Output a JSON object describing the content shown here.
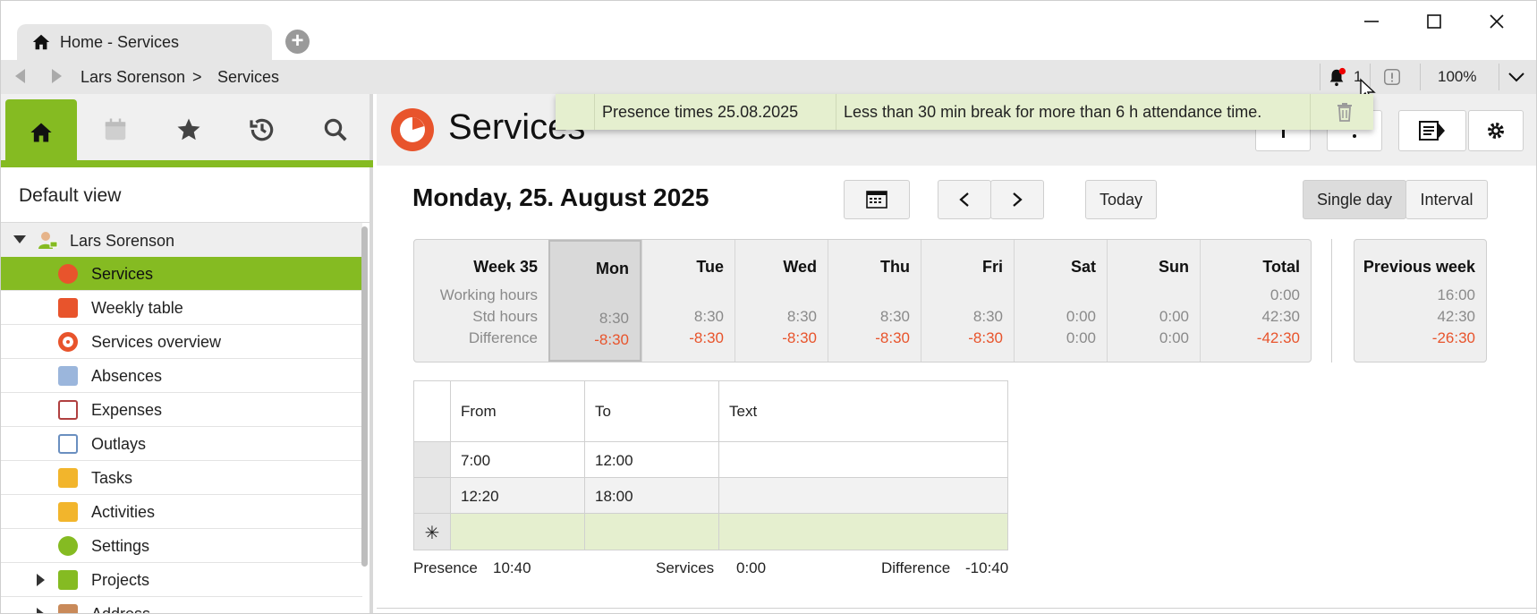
{
  "window": {
    "tab_title": "Home - Services",
    "new_tab_icon": "plus-circle-icon"
  },
  "navbar": {
    "crumb_user": "Lars Sorenson",
    "crumb_sep": ">",
    "crumb_page": "Services",
    "notif_count": "1",
    "zoom": "100%"
  },
  "sidebar": {
    "view_label": "Default view",
    "user": "Lars Sorenson",
    "items": [
      {
        "label": "Services",
        "color": "#e8542c"
      },
      {
        "label": "Weekly table",
        "color": "#e8542c"
      },
      {
        "label": "Services overview",
        "color": "#e8542c"
      },
      {
        "label": "Absences",
        "color": "#6a8fc0"
      },
      {
        "label": "Expenses",
        "color": "#b04040"
      },
      {
        "label": "Outlays",
        "color": "#6a8fc0"
      },
      {
        "label": "Tasks",
        "color": "#f2b52c"
      },
      {
        "label": "Activities",
        "color": "#f2b52c"
      },
      {
        "label": "Settings",
        "color": "#85bb22"
      },
      {
        "label": "Projects",
        "color": "#85bb22"
      },
      {
        "label": "Address",
        "color": "#c98a5a"
      }
    ]
  },
  "header": {
    "title": "Services"
  },
  "notification": {
    "title": "Presence times 25.08.2025",
    "message": "Less than 30 min break for more than 6 h attendance time."
  },
  "date_row": {
    "date": "Monday, 25. August 2025",
    "today": "Today",
    "single_day": "Single day",
    "interval": "Interval"
  },
  "week": {
    "label": "Week 35",
    "row_labels": [
      "Working hours",
      "Std hours",
      "Difference"
    ],
    "days": [
      {
        "name": "Mon",
        "working": "",
        "std": "8:30",
        "diff": "-8:30"
      },
      {
        "name": "Tue",
        "working": "",
        "std": "8:30",
        "diff": "-8:30"
      },
      {
        "name": "Wed",
        "working": "",
        "std": "8:30",
        "diff": "-8:30"
      },
      {
        "name": "Thu",
        "working": "",
        "std": "8:30",
        "diff": "-8:30"
      },
      {
        "name": "Fri",
        "working": "",
        "std": "8:30",
        "diff": "-8:30"
      },
      {
        "name": "Sat",
        "working": "",
        "std": "0:00",
        "diff": "0:00"
      },
      {
        "name": "Sun",
        "working": "",
        "std": "0:00",
        "diff": "0:00"
      },
      {
        "name": "Total",
        "working": "0:00",
        "std": "42:30",
        "diff": "-42:30"
      }
    ],
    "previous": {
      "name": "Previous week",
      "working": "16:00",
      "std": "42:30",
      "diff": "-26:30"
    }
  },
  "grid": {
    "headers": [
      "From",
      "To",
      "Text"
    ],
    "rows": [
      {
        "from": "7:00",
        "to": "12:00",
        "text": ""
      },
      {
        "from": "12:20",
        "to": "18:00",
        "text": ""
      }
    ],
    "new_row_marker": "✳"
  },
  "footer": {
    "presence_label": "Presence",
    "presence_value": "10:40",
    "services_label": "Services",
    "services_value": "0:00",
    "difference_label": "Difference",
    "difference_value": "-10:40"
  }
}
